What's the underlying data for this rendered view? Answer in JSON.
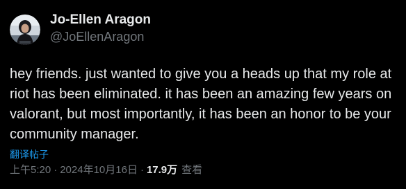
{
  "author": {
    "display_name": "Jo-Ellen Aragon",
    "handle": "@JoEllenAragon",
    "avatar_icon": "profile-photo"
  },
  "post": {
    "text": "hey friends. just wanted to give you a heads up that my role at riot has been eliminated. it has been an amazing few years on valorant, but most importantly, it has been an honor to be your community manager.",
    "translate_label": "翻译帖子"
  },
  "meta": {
    "time": "上午5:20",
    "separator": "·",
    "date": "2024年10月16日",
    "views_count": "17.9万",
    "views_label": "查看"
  },
  "colors": {
    "background": "#000000",
    "text_primary": "#e7e9ea",
    "text_secondary": "#71767b",
    "link": "#1d9bf0"
  }
}
